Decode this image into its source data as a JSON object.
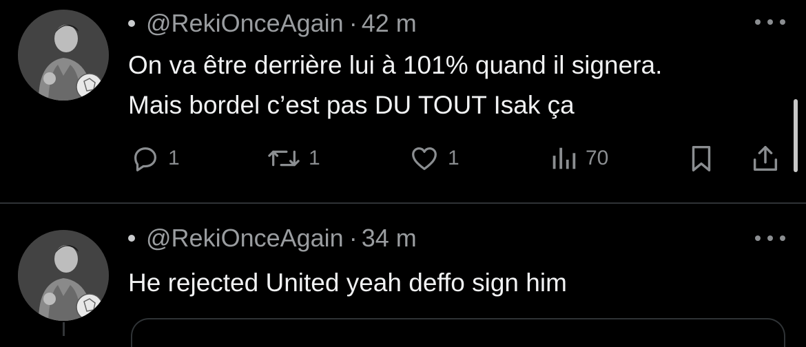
{
  "tweets": [
    {
      "handle": "@RekiOnceAgain",
      "separator": "·",
      "time": "42 m",
      "text": "On va être derrière lui à 101% quand il signera.\nMais bordel c’est pas DU TOUT Isak ça",
      "actions": {
        "reply_count": "1",
        "retweet_count": "1",
        "like_count": "1",
        "views_count": "70"
      }
    },
    {
      "handle": "@RekiOnceAgain",
      "separator": "·",
      "time": "34 m",
      "text": "He rejected United yeah deffo sign him"
    }
  ],
  "icons": {
    "reply": "reply-icon",
    "retweet": "retweet-icon",
    "like": "heart-icon",
    "views": "analytics-icon",
    "bookmark": "bookmark-icon",
    "share": "share-icon",
    "more": "more-dots-icon"
  },
  "colors": {
    "background": "#000000",
    "text": "#e7e9ea",
    "muted": "#8b8e91",
    "divider": "#2f3336"
  }
}
